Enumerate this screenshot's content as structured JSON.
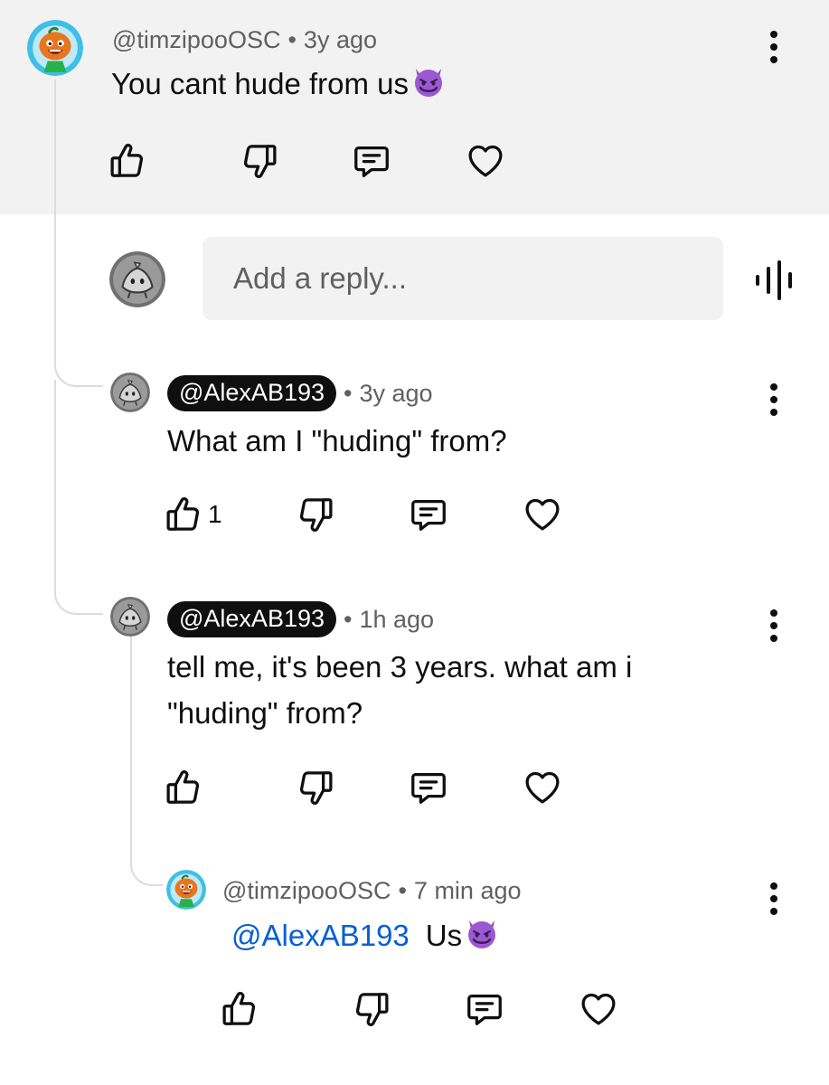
{
  "comment": {
    "author": "@timzipooOSC",
    "time": "3y ago",
    "text": "You cant hude from us",
    "emoji": "smiling-devil-emoji"
  },
  "reply_input": {
    "placeholder": "Add a reply...",
    "voice_icon": "voice-search-icon"
  },
  "replies": [
    {
      "author": "@AlexAB193",
      "time": "3y ago",
      "line1": "What am I \"huding\" from?",
      "likes": "1"
    },
    {
      "author": "@AlexAB193",
      "time": "1h ago",
      "line1": "tell me, it's been 3 years. what am i",
      "line2": "\"huding\" from?"
    },
    {
      "author": "@timzipooOSC",
      "time": "7 min ago",
      "mention": "@AlexAB193",
      "text": "Us",
      "emoji": "smiling-devil-emoji"
    }
  ],
  "separator": "•",
  "icons": [
    "thumbs-up-icon",
    "thumbs-down-icon",
    "reply-icon",
    "heart-icon",
    "more-vert-icon"
  ],
  "colors": {
    "background": "#ffffff",
    "highlight_band": "#f2f2f2",
    "chip": "#0f0f0f",
    "mention": "#065fd4",
    "meta": "#606060"
  }
}
